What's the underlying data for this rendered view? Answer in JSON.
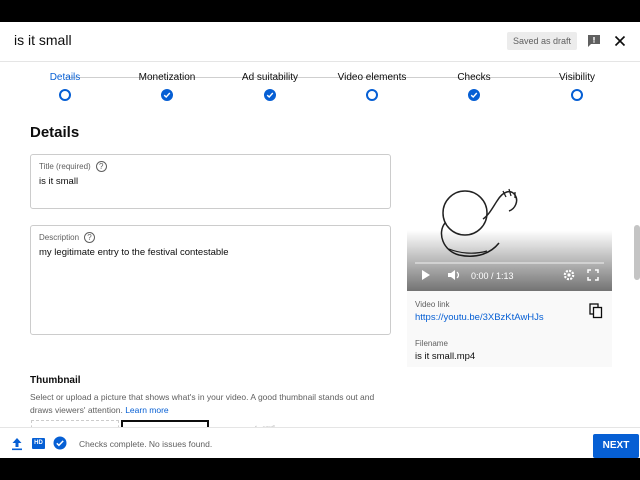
{
  "header": {
    "title": "is it small",
    "draft_status": "Saved as draft"
  },
  "stepper": {
    "steps": [
      {
        "label": "Details",
        "state": "current"
      },
      {
        "label": "Monetization",
        "state": "done"
      },
      {
        "label": "Ad suitability",
        "state": "done"
      },
      {
        "label": "Video elements",
        "state": "pending"
      },
      {
        "label": "Checks",
        "state": "done"
      },
      {
        "label": "Visibility",
        "state": "pending"
      }
    ]
  },
  "details": {
    "heading": "Details",
    "title_field": {
      "label": "Title (required)",
      "value": "is it small"
    },
    "description_field": {
      "label": "Description",
      "value": "my legitimate entry to the festival contestable"
    },
    "thumbnail": {
      "heading": "Thumbnail",
      "description": "Select or upload a picture that shows what's in your video. A good thumbnail stands out and draws viewers' attention.",
      "learn_more": "Learn more"
    }
  },
  "preview": {
    "time": "0:00 / 1:13",
    "video_link_label": "Video link",
    "video_link": "https://youtu.be/3XBzKtAwHJs",
    "filename_label": "Filename",
    "filename": "is it small.mp4"
  },
  "footer": {
    "status": "Checks complete. No issues found.",
    "next_label": "NEXT",
    "hd_badge": "HD"
  },
  "colors": {
    "accent": "#065fd4",
    "text_primary": "#0d0d0d",
    "text_secondary": "#606060"
  }
}
